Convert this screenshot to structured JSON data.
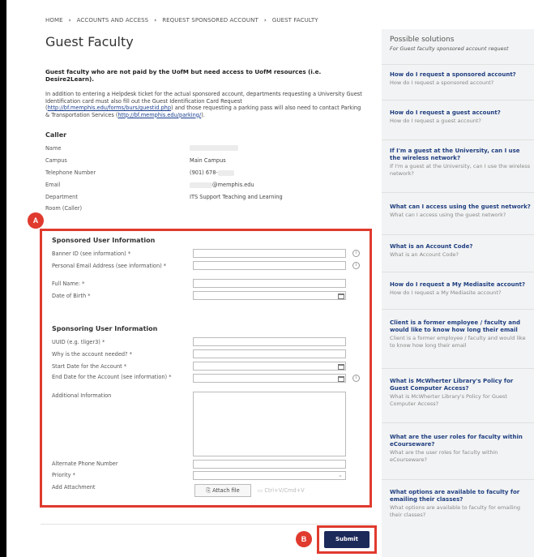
{
  "breadcrumb": [
    "HOME",
    "ACCOUNTS AND ACCESS",
    "REQUEST SPONSORED ACCOUNT",
    "GUEST FACULTY"
  ],
  "breadcrumb_sep": "›",
  "page_title": "Guest Faculty",
  "intro": {
    "bold": "Guest faculty who are not paid by the UofM but need access to UofM resources (i.e. Desire2Learn).",
    "text_1": "In addition to entering a Helpdesk ticket for the actual sponsored account, departments requesting a University Guest Identification card must also fill out the Guest Identification Card Request (",
    "link_1": "http://bf.memphis.edu/forms/burs/guestid.php",
    "text_2": ") and those requesting a parking pass will also need to contact Parking & Transportation Services (",
    "link_2": "http://bf.memphis.edu/parking/",
    "text_3": ")."
  },
  "caller": {
    "heading": "Caller",
    "rows": [
      {
        "label": "Name",
        "value": ""
      },
      {
        "label": "Campus",
        "value": "Main Campus"
      },
      {
        "label": "Telephone Number",
        "value": "(901) 678-"
      },
      {
        "label": "Email",
        "value": "@memphis.edu"
      },
      {
        "label": "Department",
        "value": "ITS Support Teaching and Learning"
      },
      {
        "label": "Room (Caller)",
        "value": ""
      }
    ]
  },
  "annotations": {
    "a": "A",
    "b": "B"
  },
  "sponsored": {
    "heading": "Sponsored User Information",
    "fields": [
      {
        "label": "Banner ID (see information) *"
      },
      {
        "label": "Personal Email Address (see information) *"
      },
      {
        "label": "Full Name: *"
      },
      {
        "label": "Date of Birth *"
      }
    ]
  },
  "sponsoring": {
    "heading": "Sponsoring User Information",
    "fields": [
      {
        "label": "UUID (e.g. tliger3) *"
      },
      {
        "label": "Why is the account needed? *"
      },
      {
        "label": "Start Date for the Account *"
      },
      {
        "label": "End Date for the Account (see information) *"
      },
      {
        "label": "Additional Information"
      },
      {
        "label": "Alternate Phone Number"
      },
      {
        "label": "Priority *"
      },
      {
        "label": "Add Attachment"
      }
    ],
    "attach_button": "Attach file",
    "paste_hint": "Ctrl+V/Cmd+V"
  },
  "submit_label": "Submit",
  "icons": {
    "info": "info-icon",
    "calendar": "calendar-icon",
    "paperclip": "paperclip-icon"
  },
  "colors": {
    "accent_red": "#e03a2e",
    "submit_navy": "#1c2a5a",
    "link_blue": "#1f3f80"
  },
  "sidebar": {
    "title": "Possible solutions",
    "subtitle": "For Guest faculty sponsored account request",
    "items": [
      {
        "q": "How do I request a sponsored account?",
        "d": "How do I request a sponsored account?"
      },
      {
        "q": "How do I request a guest account?",
        "d": "How do I request a guest account?"
      },
      {
        "q": "If I'm a guest at the University, can I use the wireless network?",
        "d": "If I'm a guest at the University, can I use the wireless network?"
      },
      {
        "q": "What can I access using the guest network?",
        "d": "What can I access using the guest network?"
      },
      {
        "q": "What is an Account Code?",
        "d": "What is an Account Code?"
      },
      {
        "q": "How do I request a My Mediasite account?",
        "d": "How do I request a My Mediasite account?"
      },
      {
        "q": "Client is a former employee / faculty and would like to know how long their email",
        "d": "Client is a former employee / faculty and would like to know how long their email"
      },
      {
        "q": "What is McWherter Library's Policy for Guest Computer Access?",
        "d": "What is McWherter Library's Policy for Guest Computer Access?"
      },
      {
        "q": "What are the user roles for faculty within eCourseware?",
        "d": "What are the user roles for faculty within eCourseware?"
      },
      {
        "q": "What options are available to faculty for emailing their classes?",
        "d": "What options are available to faculty for emailing their classes?"
      }
    ]
  }
}
